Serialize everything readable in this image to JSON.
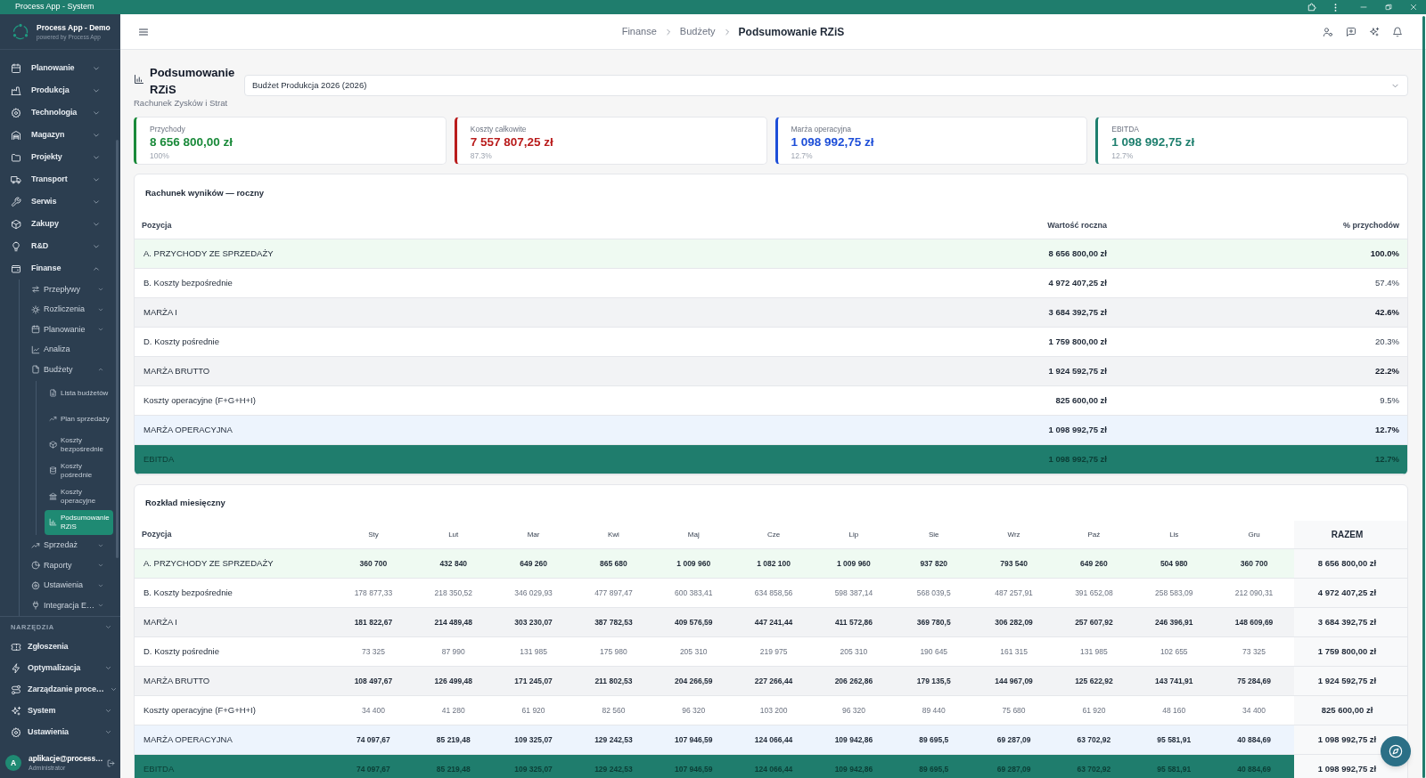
{
  "window": {
    "title": "Process App - System"
  },
  "sidebar": {
    "brand": {
      "name": "Process App - Demo",
      "tagline": "powered by Process App"
    },
    "nav": [
      {
        "label": "Planowanie",
        "kind": "group",
        "expanded": false,
        "selected": false
      },
      {
        "label": "Produkcja",
        "kind": "group",
        "expanded": false,
        "selected": false
      },
      {
        "label": "Technologia",
        "kind": "group",
        "expanded": false,
        "selected": false
      },
      {
        "label": "Magazyn",
        "kind": "group",
        "expanded": false,
        "selected": false
      },
      {
        "label": "Projekty",
        "kind": "group",
        "expanded": false,
        "selected": false
      },
      {
        "label": "Transport",
        "kind": "group",
        "expanded": false,
        "selected": false
      },
      {
        "label": "Serwis",
        "kind": "group",
        "expanded": false,
        "selected": false
      },
      {
        "label": "Zakupy",
        "kind": "group",
        "expanded": false,
        "selected": false
      },
      {
        "label": "R&D",
        "kind": "group",
        "expanded": false,
        "selected": false
      },
      {
        "label": "Finanse",
        "kind": "group",
        "expanded": true,
        "selected": false,
        "children": [
          {
            "label": "Przepływy",
            "kind": "group",
            "expanded": false,
            "selected": false
          },
          {
            "label": "Rozliczenia",
            "kind": "group",
            "expanded": false,
            "selected": false
          },
          {
            "label": "Planowanie",
            "kind": "group",
            "expanded": false,
            "selected": false
          },
          {
            "label": "Analiza",
            "kind": "link",
            "selected": false
          },
          {
            "label": "Budżety",
            "kind": "group",
            "expanded": true,
            "selected": false,
            "children": [
              {
                "label": "Lista budżetów",
                "kind": "link",
                "selected": false
              },
              {
                "label": "Plan sprzedaży",
                "kind": "link",
                "selected": false
              },
              {
                "label": "Koszty bezpośrednie",
                "kind": "link",
                "selected": false
              },
              {
                "label": "Koszty pośrednie",
                "kind": "link",
                "selected": false
              },
              {
                "label": "Koszty operacyjne",
                "kind": "link",
                "selected": false
              },
              {
                "label": "Podsumowanie RZiS",
                "kind": "link",
                "selected": true
              }
            ]
          },
          {
            "label": "Sprzedaż",
            "kind": "group",
            "expanded": false,
            "selected": false
          },
          {
            "label": "Raporty",
            "kind": "group",
            "expanded": false,
            "selected": false
          },
          {
            "label": "Ustawienia",
            "kind": "group",
            "expanded": false,
            "selected": false
          },
          {
            "label": "Integracja E…",
            "kind": "group",
            "expanded": false,
            "selected": false
          }
        ]
      }
    ],
    "tools": {
      "label": "NARZĘDZIA",
      "items": [
        {
          "label": "Zgłoszenia",
          "kind": "link",
          "selected": false
        },
        {
          "label": "Optymalizacja",
          "kind": "group",
          "expanded": false,
          "selected": false
        },
        {
          "label": "Zarządzanie proce…",
          "kind": "group",
          "expanded": false,
          "selected": false
        },
        {
          "label": "System",
          "kind": "group",
          "expanded": false,
          "selected": false
        },
        {
          "label": "Ustawienia",
          "kind": "group",
          "expanded": false,
          "selected": false
        }
      ]
    },
    "user": {
      "initial": "A",
      "email": "aplikacje@process…",
      "role": "Administrator"
    }
  },
  "header": {
    "breadcrumbs": [
      {
        "label": "Finanse",
        "current": false
      },
      {
        "label": "Budżety",
        "current": false
      },
      {
        "label": "Podsumowanie RZiS",
        "current": true
      }
    ]
  },
  "page": {
    "title": "Podsumowanie RZiS",
    "subtitle": "Rachunek Zysków i Strat",
    "budget_select": {
      "value": "Budżet Produkcja 2026 (2026)"
    }
  },
  "kpis": [
    {
      "label": "Przychody",
      "value": "8 656 800,00 zł",
      "share": "100%",
      "color": "#1a8a3a"
    },
    {
      "label": "Koszty całkowite",
      "value": "7 557 807,25 zł",
      "share": "87.3%",
      "color": "#b91c1c"
    },
    {
      "label": "Marża operacyjna",
      "value": "1 098 992,75 zł",
      "share": "12.7%",
      "color": "#1d4ed8"
    },
    {
      "label": "EBITDA",
      "value": "1 098 992,75 zł",
      "share": "12.7%",
      "color": "#1e7f6e"
    }
  ],
  "annual": {
    "title": "Rachunek wyników — roczny",
    "columns": [
      "Pozycja",
      "Wartość roczna",
      "% przychodów"
    ],
    "rows": [
      {
        "kind": "revenue",
        "label": "A. PRZYCHODY ZE SPRZEDAŻY",
        "value": "8 656 800,00 zł",
        "share": "100.0%"
      },
      {
        "kind": "cost",
        "label": "B. Koszty bezpośrednie",
        "value": "4 972 407,25 zł",
        "share": "57.4%"
      },
      {
        "kind": "margin",
        "label": "MARŻA I",
        "value": "3 684 392,75 zł",
        "share": "42.6%"
      },
      {
        "kind": "cost",
        "label": "D. Koszty pośrednie",
        "value": "1 759 800,00 zł",
        "share": "20.3%"
      },
      {
        "kind": "margin",
        "label": "MARŻA BRUTTO",
        "value": "1 924 592,75 zł",
        "share": "22.2%"
      },
      {
        "kind": "cost",
        "label": "Koszty operacyjne (F+G+H+I)",
        "value": "825 600,00 zł",
        "share": "9.5%"
      },
      {
        "kind": "operating",
        "label": "MARŻA OPERACYJNA",
        "value": "1 098 992,75 zł",
        "share": "12.7%"
      },
      {
        "kind": "ebitda",
        "label": "EBITDA",
        "value": "1 098 992,75 zł",
        "share": "12.7%"
      }
    ]
  },
  "monthly": {
    "title": "Rozkład miesięczny",
    "columns": [
      "Pozycja",
      "Sty",
      "Lut",
      "Mar",
      "Kwi",
      "Maj",
      "Cze",
      "Lip",
      "Sie",
      "Wrz",
      "Paź",
      "Lis",
      "Gru",
      "RAZEM"
    ],
    "rows": [
      {
        "kind": "revenue",
        "label": "A. PRZYCHODY ZE SPRZEDAŻY",
        "values": [
          "360 700",
          "432 840",
          "649 260",
          "865 680",
          "1 009 960",
          "1 082 100",
          "1 009 960",
          "937 820",
          "793 540",
          "649 260",
          "504 980",
          "360 700"
        ],
        "total": "8 656 800,00 zł"
      },
      {
        "kind": "cost",
        "label": "B. Koszty bezpośrednie",
        "values": [
          "178 877,33",
          "218 350,52",
          "346 029,93",
          "477 897,47",
          "600 383,41",
          "634 858,56",
          "598 387,14",
          "568 039,5",
          "487 257,91",
          "391 652,08",
          "258 583,09",
          "212 090,31"
        ],
        "total": "4 972 407,25 zł"
      },
      {
        "kind": "margin",
        "label": "MARŻA I",
        "values": [
          "181 822,67",
          "214 489,48",
          "303 230,07",
          "387 782,53",
          "409 576,59",
          "447 241,44",
          "411 572,86",
          "369 780,5",
          "306 282,09",
          "257 607,92",
          "246 396,91",
          "148 609,69"
        ],
        "total": "3 684 392,75 zł"
      },
      {
        "kind": "cost",
        "label": "D. Koszty pośrednie",
        "values": [
          "73 325",
          "87 990",
          "131 985",
          "175 980",
          "205 310",
          "219 975",
          "205 310",
          "190 645",
          "161 315",
          "131 985",
          "102 655",
          "73 325"
        ],
        "total": "1 759 800,00 zł"
      },
      {
        "kind": "margin",
        "label": "MARŻA BRUTTO",
        "values": [
          "108 497,67",
          "126 499,48",
          "171 245,07",
          "211 802,53",
          "204 266,59",
          "227 266,44",
          "206 262,86",
          "179 135,5",
          "144 967,09",
          "125 622,92",
          "143 741,91",
          "75 284,69"
        ],
        "total": "1 924 592,75 zł"
      },
      {
        "kind": "cost",
        "label": "Koszty operacyjne (F+G+H+I)",
        "values": [
          "34 400",
          "41 280",
          "61 920",
          "82 560",
          "96 320",
          "103 200",
          "96 320",
          "89 440",
          "75 680",
          "61 920",
          "48 160",
          "34 400"
        ],
        "total": "825 600,00 zł"
      },
      {
        "kind": "operating",
        "label": "MARŻA OPERACYJNA",
        "values": [
          "74 097,67",
          "85 219,48",
          "109 325,07",
          "129 242,53",
          "107 946,59",
          "124 066,44",
          "109 942,86",
          "89 695,5",
          "69 287,09",
          "63 702,92",
          "95 581,91",
          "40 884,69"
        ],
        "total": "1 098 992,75 zł"
      },
      {
        "kind": "ebitda",
        "label": "EBITDA",
        "values": [
          "74 097,67",
          "85 219,48",
          "109 325,07",
          "129 242,53",
          "107 946,59",
          "124 066,44",
          "109 942,86",
          "89 695,5",
          "69 287,09",
          "63 702,92",
          "95 581,91",
          "40 884,69"
        ],
        "total": "1 098 992,75 zł"
      }
    ]
  }
}
